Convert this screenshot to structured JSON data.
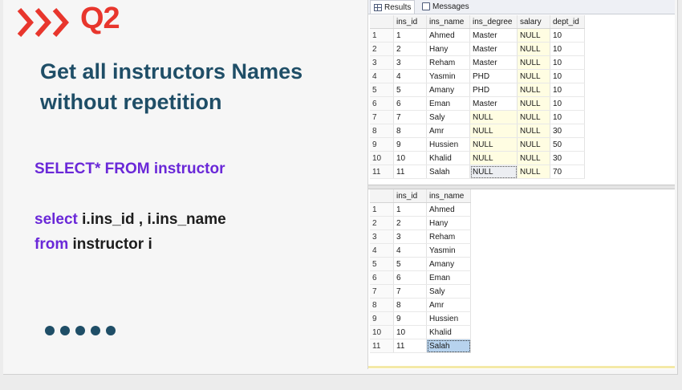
{
  "slide": {
    "question": "Q2",
    "heading": "Get all instructors Names without repetition",
    "code_line1": "SELECT* FROM instructor",
    "code_line2_kw": "select",
    "code_line2_rest": " i.ins_id , i.ins_name",
    "code_line3_kw": "from",
    "code_line3_rest": " instructor i",
    "colors": {
      "accent": "#e8362d",
      "heading": "#1f4e67",
      "keyword": "#6a28d8"
    }
  },
  "tabs": [
    {
      "label": "Results",
      "icon": "grid-icon"
    },
    {
      "label": "Messages",
      "icon": "messages-icon"
    }
  ],
  "grid1": {
    "columns": [
      "ins_id",
      "ins_name",
      "ins_degree",
      "salary",
      "dept_id"
    ],
    "rows": [
      [
        "1",
        "Ahmed",
        "Master",
        "NULL",
        "10"
      ],
      [
        "2",
        "Hany",
        "Master",
        "NULL",
        "10"
      ],
      [
        "3",
        "Reham",
        "Master",
        "NULL",
        "10"
      ],
      [
        "4",
        "Yasmin",
        "PHD",
        "NULL",
        "10"
      ],
      [
        "5",
        "Amany",
        "PHD",
        "NULL",
        "10"
      ],
      [
        "6",
        "Eman",
        "Master",
        "NULL",
        "10"
      ],
      [
        "7",
        "Saly",
        "NULL",
        "NULL",
        "10"
      ],
      [
        "8",
        "Amr",
        "NULL",
        "NULL",
        "30"
      ],
      [
        "9",
        "Hussien",
        "NULL",
        "NULL",
        "50"
      ],
      [
        "10",
        "Khalid",
        "NULL",
        "NULL",
        "30"
      ],
      [
        "11",
        "Salah",
        "NULL",
        "NULL",
        "70"
      ]
    ]
  },
  "grid2": {
    "columns": [
      "ins_id",
      "ins_name"
    ],
    "rows": [
      [
        "1",
        "Ahmed"
      ],
      [
        "2",
        "Hany"
      ],
      [
        "3",
        "Reham"
      ],
      [
        "4",
        "Yasmin"
      ],
      [
        "5",
        "Amany"
      ],
      [
        "6",
        "Eman"
      ],
      [
        "7",
        "Saly"
      ],
      [
        "8",
        "Amr"
      ],
      [
        "9",
        "Hussien"
      ],
      [
        "10",
        "Khalid"
      ],
      [
        "11",
        "Salah"
      ]
    ]
  }
}
